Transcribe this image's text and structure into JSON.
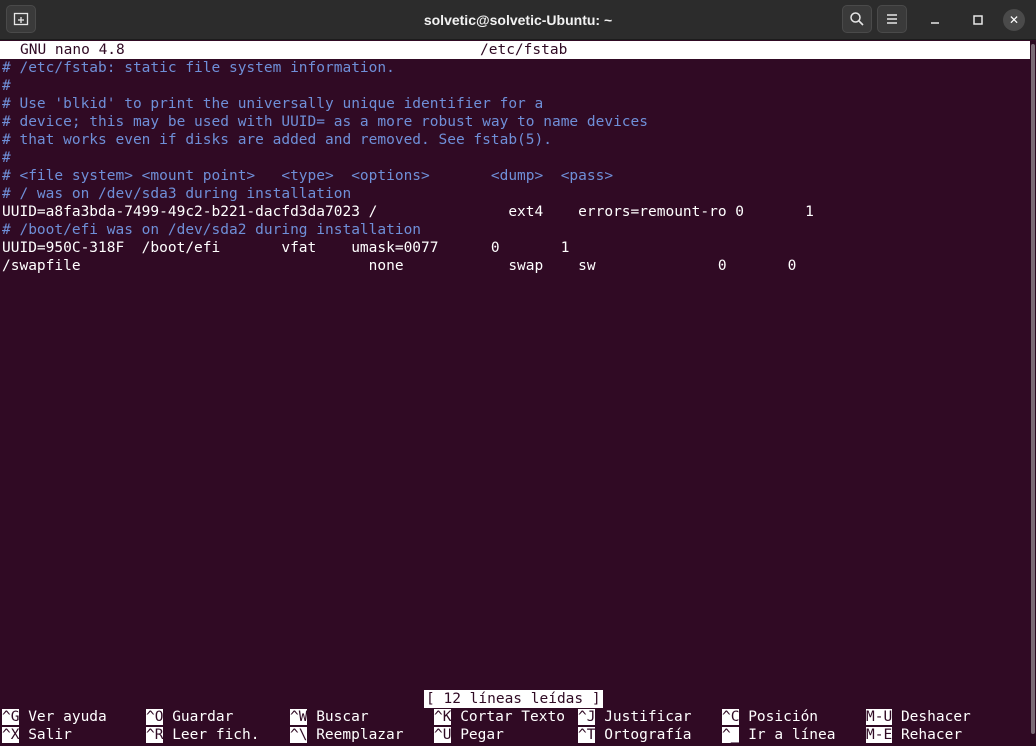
{
  "window": {
    "title": "solvetic@solvetic-Ubuntu: ~"
  },
  "icons": {
    "new_tab": "new-tab-icon",
    "search": "search-icon",
    "menu": "hamburger-menu-icon",
    "minimize": "minimize-icon",
    "maximize": "maximize-icon",
    "close": "close-icon"
  },
  "colors": {
    "terminal_background": "#300a24",
    "comment_text": "#6f8fd8",
    "normal_text": "#ffffff"
  },
  "nano": {
    "version": "GNU nano 4.8",
    "filename": "/etc/fstab",
    "status": "[ 12 líneas leídas ]"
  },
  "lines": [
    "# /etc/fstab: static file system information.",
    "#",
    "# Use 'blkid' to print the universally unique identifier for a",
    "# device; this may be used with UUID= as a more robust way to name devices",
    "# that works even if disks are added and removed. See fstab(5).",
    "#",
    "# <file system> <mount point>   <type>  <options>       <dump>  <pass>",
    "# / was on /dev/sda3 during installation",
    "UUID=a8fa3bda-7499-49c2-b221-dacfd3da7023 /               ext4    errors=remount-ro 0       1",
    "# /boot/efi was on /dev/sda2 during installation",
    "UUID=950C-318F  /boot/efi       vfat    umask=0077      0       1",
    "/swapfile                                 none            swap    sw              0       0"
  ],
  "shortcuts_row1": [
    {
      "key": "^G",
      "label": "Ver ayuda"
    },
    {
      "key": "^O",
      "label": "Guardar"
    },
    {
      "key": "^W",
      "label": "Buscar"
    },
    {
      "key": "^K",
      "label": "Cortar Texto"
    },
    {
      "key": "^J",
      "label": "Justificar"
    },
    {
      "key": "^C",
      "label": "Posición"
    },
    {
      "key": "M-U",
      "label": "Deshacer"
    }
  ],
  "shortcuts_row2": [
    {
      "key": "^X",
      "label": "Salir"
    },
    {
      "key": "^R",
      "label": "Leer fich."
    },
    {
      "key": "^\\",
      "label": "Reemplazar"
    },
    {
      "key": "^U",
      "label": "Pegar"
    },
    {
      "key": "^T",
      "label": "Ortografía"
    },
    {
      "key": "^_",
      "label": "Ir a línea"
    },
    {
      "key": "M-E",
      "label": "Rehacer"
    }
  ]
}
